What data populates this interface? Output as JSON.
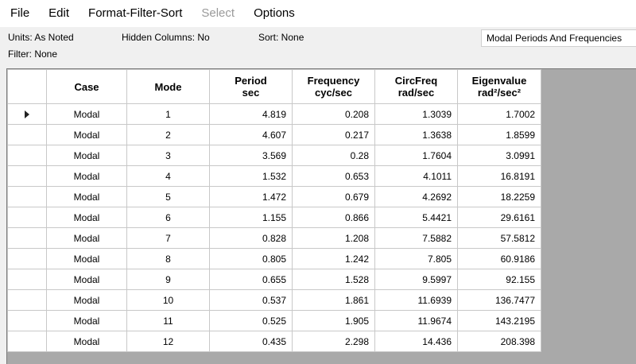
{
  "menu": [
    "File",
    "Edit",
    "Format-Filter-Sort",
    "Select",
    "Options"
  ],
  "menu_disabled": [
    "Select"
  ],
  "info": {
    "units": "Units:  As Noted",
    "hidden_columns": "Hidden Columns:  No",
    "sort": "Sort:  None",
    "filter": "Filter:  None"
  },
  "table_selector": "Modal Periods And Frequencies",
  "columns": [
    {
      "line1": "Case",
      "line2": ""
    },
    {
      "line1": "Mode",
      "line2": ""
    },
    {
      "line1": "Period",
      "line2": "sec"
    },
    {
      "line1": "Frequency",
      "line2": "cyc/sec"
    },
    {
      "line1": "CircFreq",
      "line2": "rad/sec"
    },
    {
      "line1": "Eigenvalue",
      "line2": "rad²/sec²"
    }
  ],
  "rows": [
    [
      "Modal",
      "1",
      "4.819",
      "0.208",
      "1.3039",
      "1.7002"
    ],
    [
      "Modal",
      "2",
      "4.607",
      "0.217",
      "1.3638",
      "1.8599"
    ],
    [
      "Modal",
      "3",
      "3.569",
      "0.28",
      "1.7604",
      "3.0991"
    ],
    [
      "Modal",
      "4",
      "1.532",
      "0.653",
      "4.1011",
      "16.8191"
    ],
    [
      "Modal",
      "5",
      "1.472",
      "0.679",
      "4.2692",
      "18.2259"
    ],
    [
      "Modal",
      "6",
      "1.155",
      "0.866",
      "5.4421",
      "29.6161"
    ],
    [
      "Modal",
      "7",
      "0.828",
      "1.208",
      "7.5882",
      "57.5812"
    ],
    [
      "Modal",
      "8",
      "0.805",
      "1.242",
      "7.805",
      "60.9186"
    ],
    [
      "Modal",
      "9",
      "0.655",
      "1.528",
      "9.5997",
      "92.155"
    ],
    [
      "Modal",
      "10",
      "0.537",
      "1.861",
      "11.6939",
      "136.7477"
    ],
    [
      "Modal",
      "11",
      "0.525",
      "1.905",
      "11.9674",
      "143.2195"
    ],
    [
      "Modal",
      "12",
      "0.435",
      "2.298",
      "14.436",
      "208.398"
    ]
  ],
  "selected_row_index": 0
}
